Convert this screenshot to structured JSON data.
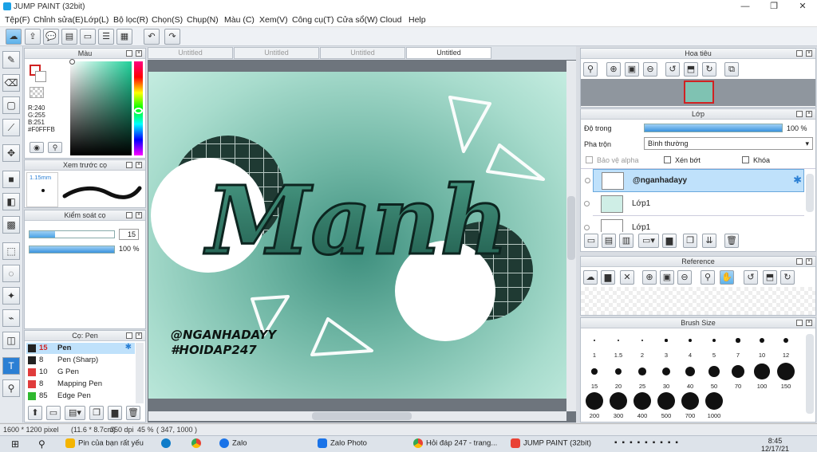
{
  "window": {
    "title": "JUMP PAINT (32bit)",
    "controls": [
      "—",
      "❐",
      "✕"
    ]
  },
  "menu": [
    "Tệp(F)",
    "Chỉnh sửa(E)",
    "Lớp(L)",
    "Bộ lọc(R)",
    "Chọn(S)",
    "Chụp(N)",
    "Màu (C)",
    "Xem(V)",
    "Công cụ(T)",
    "Cửa sổ(W)",
    "Cloud",
    "Help"
  ],
  "tabs": [
    "Untitled",
    "Untitled",
    "Untitled",
    "Untitled"
  ],
  "color_panel": {
    "title": "Màu",
    "r": "R:240",
    "g": "G:255",
    "b": "B:251",
    "hex": "#F0FFFB"
  },
  "preview_panel": {
    "title": "Xem trước cọ",
    "size": "1.15mm"
  },
  "brush_control": {
    "title": "Kiểm soát cọ",
    "size_value": "15",
    "opacity_value": "100 %",
    "size_fill": 0.3,
    "opacity_fill": 1.0
  },
  "brush_list": {
    "title": "Cọ: Pen",
    "items": [
      {
        "size": "15",
        "name": "Pen",
        "color": "#222222",
        "selected": true
      },
      {
        "size": "8",
        "name": "Pen (Sharp)",
        "color": "#222222",
        "selected": false
      },
      {
        "size": "10",
        "name": "G Pen",
        "color": "#e03b3b",
        "selected": false
      },
      {
        "size": "8",
        "name": "Mapping Pen",
        "color": "#e03b3b",
        "selected": false
      },
      {
        "size": "85",
        "name": "Edge Pen",
        "color": "#2fb82f",
        "selected": false
      }
    ]
  },
  "canvas": {
    "lettering": "Manh",
    "handle1": "@NGANHADAYY",
    "handle2": "#HOIDAP247"
  },
  "navigator": {
    "title": "Hoa tiêu"
  },
  "layers": {
    "title": "Lớp",
    "opacity_label": "Độ trong",
    "opacity_value": "100 %",
    "blend_label": "Pha trộn",
    "blend_value": "Bình thường",
    "protect_alpha": "Bảo vệ alpha",
    "clipping": "Xén bớt",
    "lock": "Khóa",
    "items": [
      {
        "name": "@nganhadayy",
        "selected": true
      },
      {
        "name": "Lớp1",
        "selected": false
      },
      {
        "name": "Lớp1",
        "selected": false
      }
    ]
  },
  "reference": {
    "title": "Reference"
  },
  "brush_size": {
    "title": "Brush Size",
    "row1": [
      "1",
      "1.5",
      "2",
      "3",
      "4",
      "5",
      "7",
      "10",
      "12"
    ],
    "row2": [
      "15",
      "20",
      "25",
      "30",
      "40",
      "50",
      "70",
      "100",
      "150"
    ],
    "row3": [
      "200",
      "300",
      "400",
      "500",
      "700",
      "1000"
    ]
  },
  "status": {
    "dimensions": "1600 * 1200 pixel",
    "physical": "(11.6 * 8.7cm)",
    "dpi": "350 dpi",
    "zoom": "45 %",
    "cursor": "( 347, 1000 )"
  },
  "taskbar": {
    "items": [
      {
        "label": "Pin của bạn rất yếu",
        "color": "#f4b400"
      },
      {
        "label": "Zalo",
        "color": "#1a73e8"
      },
      {
        "label": "Zalo Photo",
        "color": "#1a73e8"
      },
      {
        "label": "Hỏi đáp 247 - trang...",
        "color": "#e94235"
      },
      {
        "label": "JUMP PAINT (32bit)",
        "color": "#e94235"
      }
    ],
    "time": "8:45",
    "date": "12/17/21"
  }
}
